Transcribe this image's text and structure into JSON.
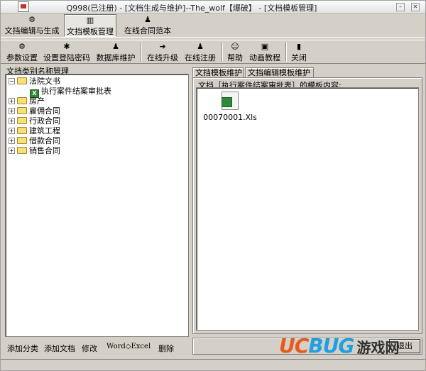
{
  "window": {
    "title": "Q998(已注册) - [文档生成与维护]--The_wolf【爆破】 - [文档模板管理]",
    "minimize_glyph": "–",
    "close_glyph": "✕"
  },
  "main_tabs": [
    {
      "label": "文挡编辑与生成",
      "icon": "gear-icon"
    },
    {
      "label": "文挡模板管理",
      "icon": "template-icon",
      "active": true
    },
    {
      "label": "在线合同范本",
      "icon": "person-icon"
    }
  ],
  "toolbar": [
    {
      "label": "参数设置",
      "icon": "settings-icon"
    },
    {
      "label": "设置登陆密码",
      "icon": "password-icon"
    },
    {
      "label": "数据库维护",
      "icon": "database-icon"
    },
    {
      "label": "在线升级",
      "icon": "upgrade-icon"
    },
    {
      "label": "在线注册",
      "icon": "register-icon"
    },
    {
      "label": "帮助",
      "icon": "help-icon"
    },
    {
      "label": "动画教程",
      "icon": "tutorial-icon"
    },
    {
      "label": "关闭",
      "icon": "close-icon"
    }
  ],
  "left_panel": {
    "title": "文挡类别名称管理",
    "tree": [
      {
        "label": "法院文书",
        "expanded": true,
        "children": [
          {
            "label": "执行案件结案审批表"
          }
        ]
      },
      {
        "label": "房产"
      },
      {
        "label": "雇佣合同"
      },
      {
        "label": "行政合同"
      },
      {
        "label": "建筑工程"
      },
      {
        "label": "借款合同"
      },
      {
        "label": "销售合同"
      }
    ],
    "buttons": [
      "添加分类",
      "添加文档",
      "修改",
      "Word◇Excel",
      "删除"
    ]
  },
  "right_panel": {
    "tabs": [
      "文挡模板维护",
      "文挡编辑模板维护"
    ],
    "group_label": "文挡［执行案件结案审批表］的模板内容:",
    "files": [
      {
        "name": "00070001.Xls",
        "icon": "excel-file-icon"
      }
    ],
    "exit_label": "退出"
  },
  "watermark": {
    "uc": "UC",
    "bug": "BUG",
    "cn": "游戏网"
  },
  "colors": {
    "window_bg": "#d4d0c8",
    "excel_green": "#2f8a3c",
    "folder_yellow": "#f7e07a"
  }
}
